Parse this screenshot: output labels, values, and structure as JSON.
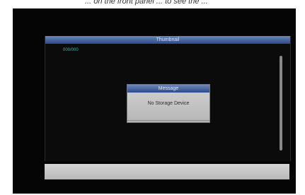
{
  "top_caption": "... on the front panel ... to see the ... ",
  "panel": {
    "title": "Thumbnail",
    "page_count": "000/000"
  },
  "dialog": {
    "title": "Message",
    "message": "No Storage Device"
  },
  "colors": {
    "titlebar": "#3a5a9c",
    "page_count_text": "#3fb8a6",
    "dialog_body": "#c8c8c8",
    "footer_bar": "#c8c8c8"
  }
}
